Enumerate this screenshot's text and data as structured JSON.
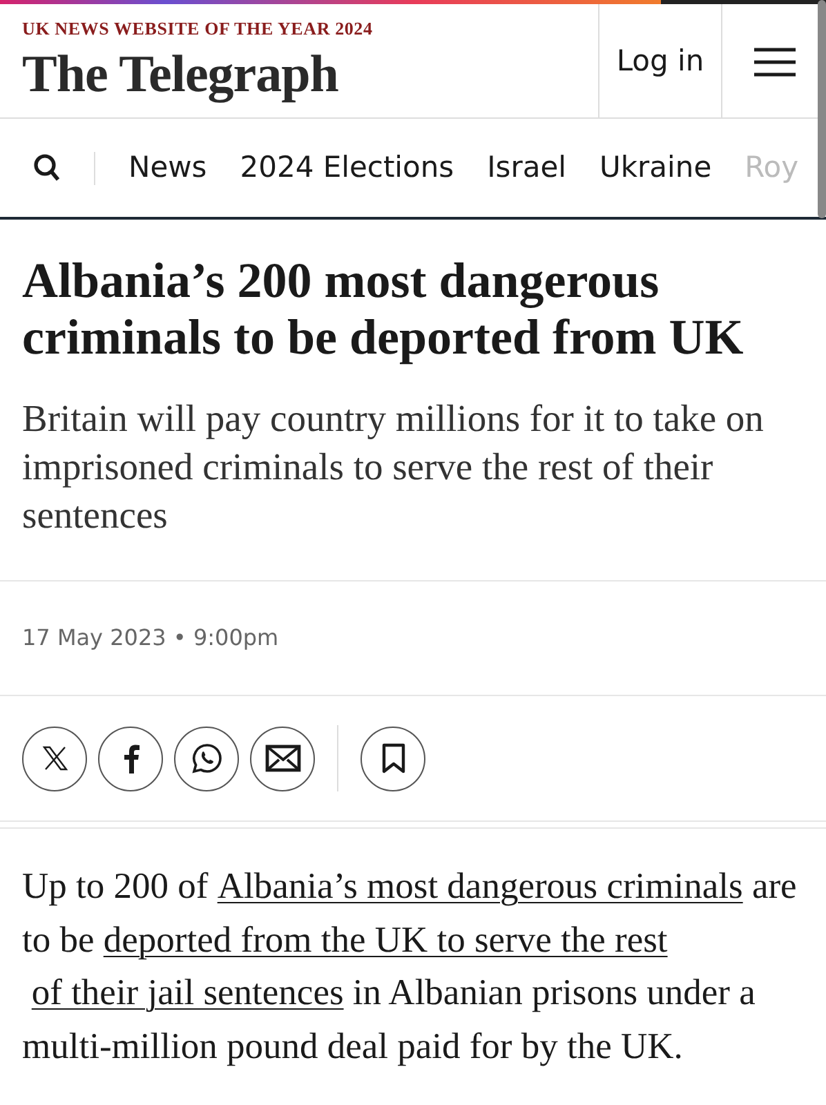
{
  "header": {
    "award": "UK NEWS WEBSITE OF THE YEAR 2024",
    "logo": "The Telegraph",
    "login": "Log in"
  },
  "nav": [
    {
      "label": "News",
      "faded": false
    },
    {
      "label": "2024 Elections",
      "faded": false
    },
    {
      "label": "Israel",
      "faded": false
    },
    {
      "label": "Ukraine",
      "faded": false
    },
    {
      "label": "Roy",
      "faded": true
    }
  ],
  "article": {
    "headline": "Albania’s 200 most dangerous criminals to be deported from UK",
    "standfirst": "Britain will pay country millions for it to take on imprisoned criminals to serve the rest of their sentences",
    "date": "17 May 2023 • 9:00pm",
    "body": [
      {
        "kind": "text",
        "text": "Up to 200 of "
      },
      {
        "kind": "link",
        "text": "Albania’s most dangerous criminals"
      },
      {
        "kind": "text",
        "text": " are to be "
      },
      {
        "kind": "link",
        "text": "deported from the UK to serve the rest"
      },
      {
        "kind": "link",
        "text": "of their jail sentences"
      },
      {
        "kind": "text",
        "text": " in Albanian prisons under a multi-million pound deal paid for by the UK."
      }
    ]
  }
}
